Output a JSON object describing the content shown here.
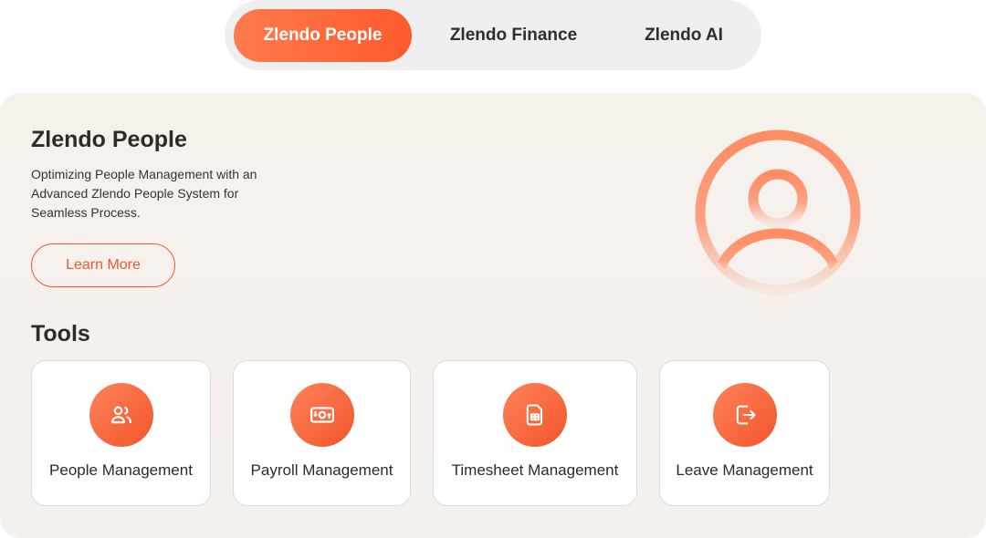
{
  "tabs": [
    {
      "label": "Zlendo People",
      "active": true
    },
    {
      "label": "Zlendo Finance",
      "active": false
    },
    {
      "label": "Zlendo AI",
      "active": false
    }
  ],
  "product": {
    "title": "Zlendo People",
    "description": "Optimizing People Management with an Advanced Zlendo People System for Seamless Process.",
    "learn_more_label": "Learn More",
    "hero_icon": "user-circle-icon"
  },
  "tools": {
    "title": "Tools",
    "items": [
      {
        "label": "People Management",
        "icon": "users-icon"
      },
      {
        "label": "Payroll Management",
        "icon": "banknote-icon"
      },
      {
        "label": "Timesheet Management",
        "icon": "spreadsheet-file-icon"
      },
      {
        "label": "Leave Management",
        "icon": "exit-door-icon"
      }
    ]
  },
  "colors": {
    "accent": "#f2552a",
    "accent_light": "#ff825a",
    "panel_bg": "#f5f0ec",
    "tab_bar_bg": "#efefef"
  }
}
